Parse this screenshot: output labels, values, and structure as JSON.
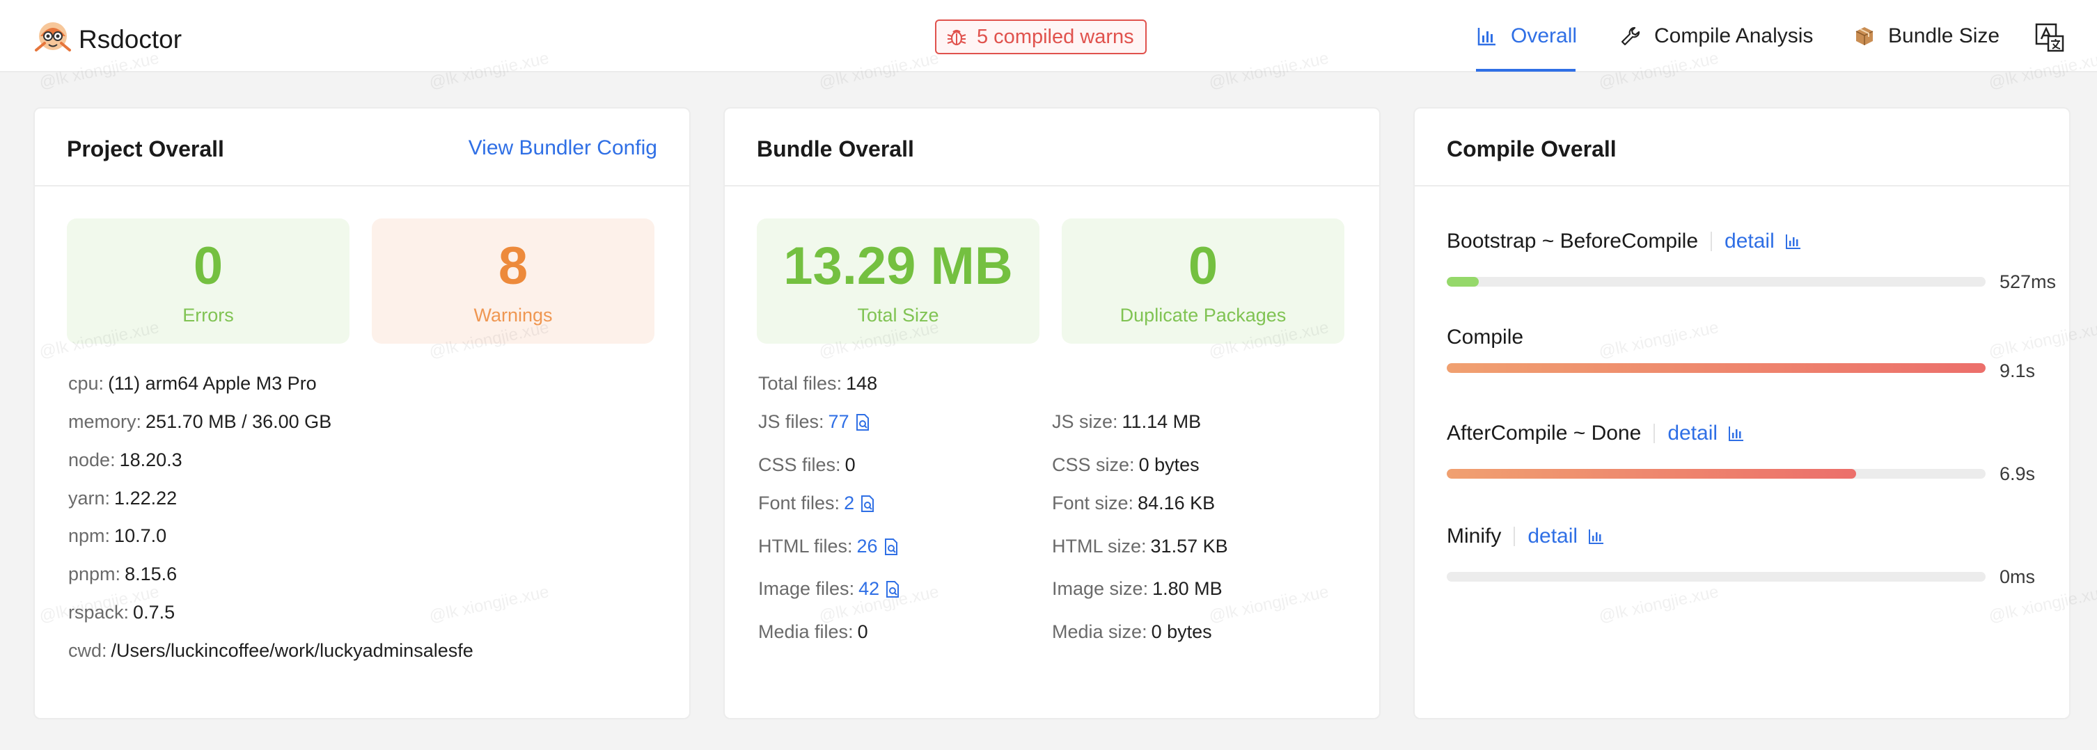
{
  "app": {
    "brand": "Rsdoctor"
  },
  "header": {
    "warn_badge": "5 compiled warns",
    "nav": [
      {
        "label": "Overall",
        "icon": "bar-chart-icon",
        "active": true
      },
      {
        "label": "Compile Analysis",
        "icon": "wrench-icon",
        "active": false
      },
      {
        "label": "Bundle Size",
        "icon": "package-icon",
        "active": false
      }
    ]
  },
  "project": {
    "title": "Project Overall",
    "config_link": "View Bundler Config",
    "errors": {
      "value": "0",
      "label": "Errors"
    },
    "warnings": {
      "value": "8",
      "label": "Warnings"
    },
    "env": [
      {
        "key": "cpu",
        "value": "(11) arm64 Apple M3 Pro"
      },
      {
        "key": "memory",
        "value": "251.70 MB / 36.00 GB"
      },
      {
        "key": "node",
        "value": "18.20.3"
      },
      {
        "key": "yarn",
        "value": "1.22.22"
      },
      {
        "key": "npm",
        "value": "10.7.0"
      },
      {
        "key": "pnpm",
        "value": "8.15.6"
      },
      {
        "key": "rspack",
        "value": "0.7.5"
      },
      {
        "key": "cwd",
        "value": "/Users/luckincoffee/work/luckyadminsalesfe"
      }
    ]
  },
  "bundle": {
    "title": "Bundle Overall",
    "total_size": {
      "value": "13.29 MB",
      "label": "Total Size"
    },
    "duplicates": {
      "value": "0",
      "label": "Duplicate Packages"
    },
    "total_files": {
      "key": "Total files",
      "value": "148"
    },
    "files": [
      {
        "key": "JS files",
        "value": "77",
        "link": true
      },
      {
        "key": "CSS files",
        "value": "0",
        "link": false
      },
      {
        "key": "Font files",
        "value": "2",
        "link": true
      },
      {
        "key": "HTML files",
        "value": "26",
        "link": true
      },
      {
        "key": "Image files",
        "value": "42",
        "link": true
      },
      {
        "key": "Media files",
        "value": "0",
        "link": false
      }
    ],
    "sizes": [
      {
        "key": "JS size",
        "value": "11.14 MB"
      },
      {
        "key": "CSS size",
        "value": "0 bytes"
      },
      {
        "key": "Font size",
        "value": "84.16 KB"
      },
      {
        "key": "HTML size",
        "value": "31.57 KB"
      },
      {
        "key": "Image size",
        "value": "1.80 MB"
      },
      {
        "key": "Media size",
        "value": "0 bytes"
      }
    ]
  },
  "compile": {
    "title": "Compile Overall",
    "phases": [
      {
        "name": "Bootstrap ~ BeforeCompile",
        "detail": "detail",
        "duration": "527ms",
        "progress": 0.06,
        "color": "#95d86a"
      },
      {
        "name": "Compile",
        "detail": "",
        "duration": "9.1s",
        "progress": 1.0,
        "color": "gradient"
      },
      {
        "name": "AfterCompile ~ Done",
        "detail": "detail",
        "duration": "6.9s",
        "progress": 0.76,
        "color": "gradient"
      },
      {
        "name": "Minify",
        "detail": "detail",
        "duration": "0ms",
        "progress": 0.0,
        "color": "gradient"
      }
    ]
  },
  "watermark": "@lk xiongjie.xue",
  "colors": {
    "accent": "#2f6fe5",
    "error": "#e0524d",
    "success": "#74c040",
    "warning": "#ed8a3b"
  }
}
